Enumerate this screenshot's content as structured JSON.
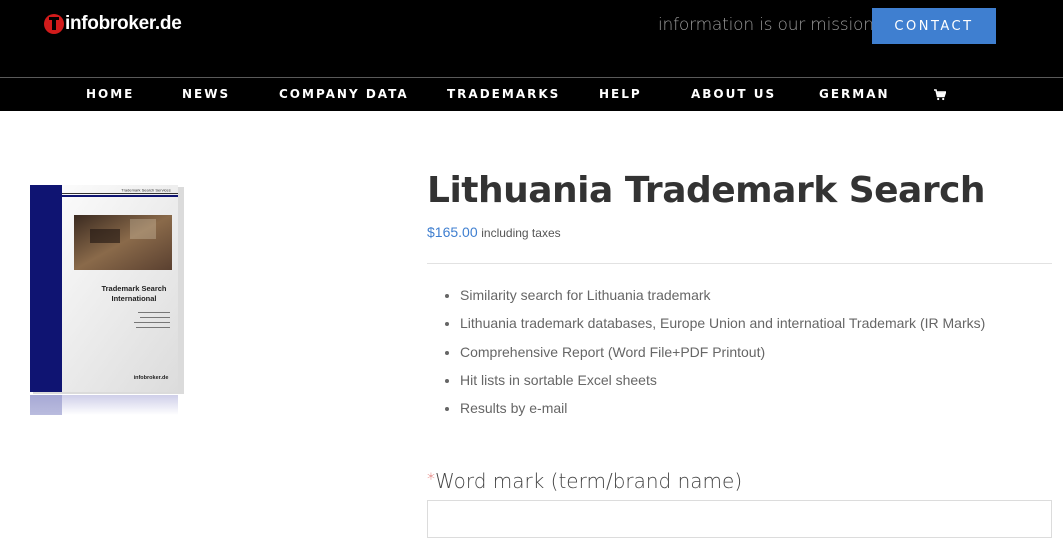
{
  "header": {
    "logo_text": "infobroker.de",
    "tagline": "information is our mission",
    "contact_label": "CONTACT"
  },
  "nav": {
    "items": [
      {
        "label": "HOME"
      },
      {
        "label": "NEWS"
      },
      {
        "label": "COMPANY DATA"
      },
      {
        "label": "TRADEMARKS"
      },
      {
        "label": "HELP"
      },
      {
        "label": "ABOUT US"
      },
      {
        "label": "GERMAN"
      }
    ],
    "cart_icon": "shopping-cart-icon"
  },
  "product": {
    "title": "Lithuania Trademark Search",
    "price": "$165.00",
    "price_note": "including taxes",
    "features": [
      "Similarity search for Lithuania trademark",
      "Lithuania trademark databases, Europe Union and internatioal Trademark (IR Marks)",
      "Comprehensive Report (Word File+PDF Printout)",
      "Hit lists in sortable Excel sheets",
      "Results by e-mail"
    ],
    "image": {
      "header_text": "Trademark Search Services",
      "title_line1": "Trademark Search",
      "title_line2": "International",
      "brand": "infobroker.de"
    }
  },
  "form": {
    "required_mark": "*",
    "wordmark_label": "Word mark (term/brand name)",
    "wordmark_value": ""
  },
  "colors": {
    "accent": "#3f7fd0",
    "header_bg": "#000000",
    "title": "#333333",
    "required": "#d9534f"
  }
}
